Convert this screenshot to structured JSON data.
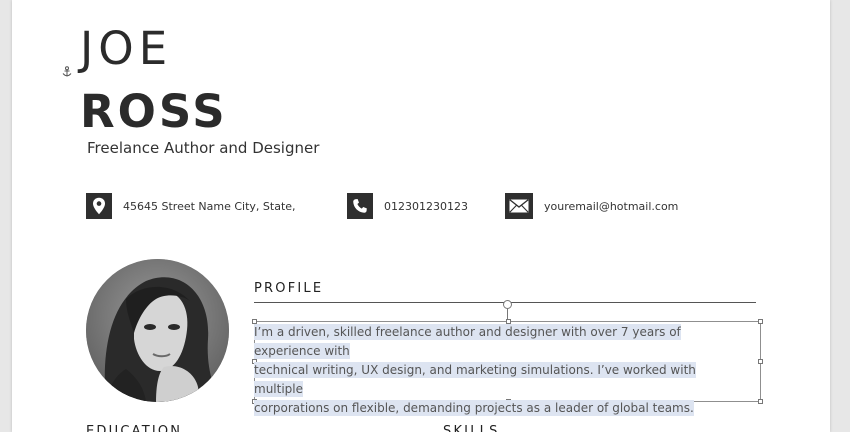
{
  "resume": {
    "first_name": "JOE",
    "last_name": "ROSS",
    "subtitle": "Freelance Author and Designer",
    "contacts": [
      {
        "icon": "location-pin-icon",
        "text": "45645 Street Name City, State,"
      },
      {
        "icon": "phone-icon",
        "text": "012301230123"
      },
      {
        "icon": "email-icon",
        "text": "youremail@hotmail.com"
      }
    ],
    "profile": {
      "heading": "PROFILE",
      "lines": [
        "I’m a driven, skilled freelance author and designer with over 7 years of experience with",
        "technical writing, UX design, and marketing simulations. I’ve worked with multiple",
        "corporations on flexible, demanding projects as a leader of global teams."
      ]
    },
    "education_heading": "EDUCATION",
    "skills_heading": "SKILLS"
  },
  "colors": {
    "accent_dark": "#2f2f2f",
    "selection": "#dde4f1",
    "page_bg": "#ffffff",
    "outer_bg": "#e7e7e7"
  }
}
